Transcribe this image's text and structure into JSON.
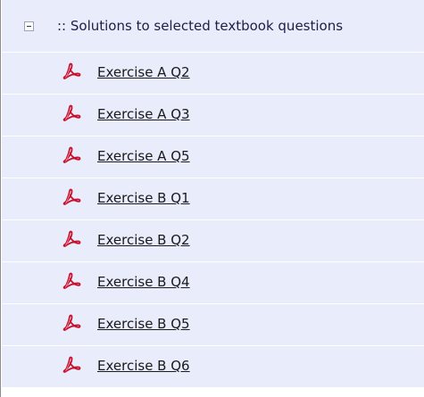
{
  "section": {
    "title": ":: Solutions to selected textbook questions",
    "collapse_icon": "minus-box-icon",
    "bg_color": "#e8ecfb"
  },
  "items": [
    {
      "label": "Exercise A Q2",
      "icon": "pdf-icon"
    },
    {
      "label": "Exercise A Q3",
      "icon": "pdf-icon"
    },
    {
      "label": "Exercise A Q5",
      "icon": "pdf-icon"
    },
    {
      "label": "Exercise B Q1",
      "icon": "pdf-icon"
    },
    {
      "label": "Exercise B Q2",
      "icon": "pdf-icon"
    },
    {
      "label": "Exercise B Q4",
      "icon": "pdf-icon"
    },
    {
      "label": "Exercise B Q5",
      "icon": "pdf-icon"
    },
    {
      "label": "Exercise B Q6",
      "icon": "pdf-icon"
    }
  ]
}
